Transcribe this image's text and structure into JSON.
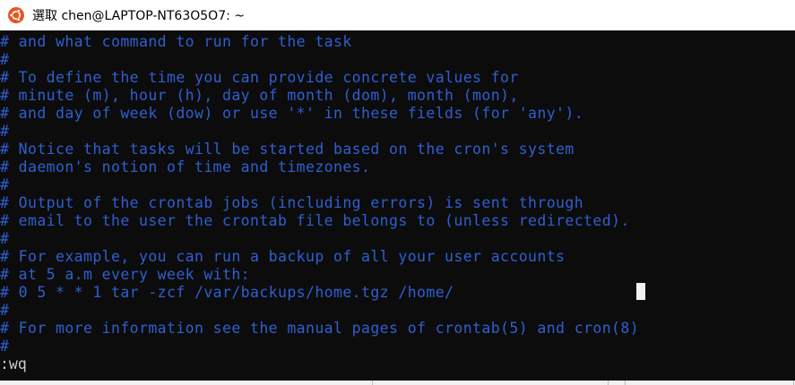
{
  "window": {
    "title": "選取 chen@LAPTOP-NT63O5O7: ~",
    "app_icon": "ubuntu-icon",
    "accent_color": "#e95420"
  },
  "terminal": {
    "comment_color": "#2f5fd0",
    "background": "#0c0c0c",
    "lines": [
      "# and what command to run for the task",
      "#",
      "# To define the time you can provide concrete values for",
      "# minute (m), hour (h), day of month (dom), month (mon),",
      "# and day of week (dow) or use '*' in these fields (for 'any').",
      "#",
      "# Notice that tasks will be started based on the cron's system",
      "# daemon's notion of time and timezones.",
      "#",
      "# Output of the crontab jobs (including errors) is sent through",
      "# email to the user the crontab file belongs to (unless redirected).",
      "#",
      "# For example, you can run a backup of all your user accounts",
      "# at 5 a.m every week with:",
      "# 0 5 * * 1 tar -zcf /var/backups/home.tgz /home/",
      "#",
      "# For more information see the manual pages of crontab(5) and cron(8)",
      "#"
    ],
    "command_line": ":wq"
  }
}
